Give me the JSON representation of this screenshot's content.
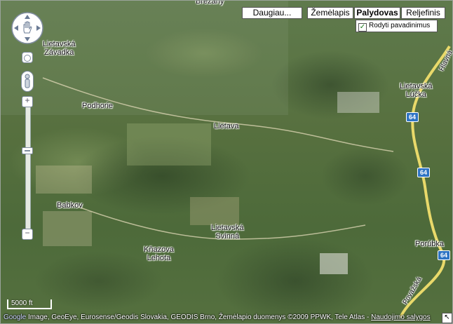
{
  "map_types": [
    {
      "label": "Daugiau...",
      "active": false
    },
    {
      "label": "Žemėlapis",
      "active": false
    },
    {
      "label": "Palydovas",
      "active": true
    },
    {
      "label": "Reljefinis",
      "active": false
    }
  ],
  "labels_toggle": {
    "label": "Rodyti pavadinimus",
    "checked": true
  },
  "places": {
    "brezany": "Brezany",
    "lietavska_zavadka_1": "Lietavská",
    "lietavska_zavadka_2": "Závadka",
    "podhorie": "Podhorie",
    "lietava": "Lietava",
    "lietavska_lucka_1": "Lietavská",
    "lietavska_lucka_2": "Lúčka",
    "babkov": "Babkov",
    "lietavska_svinna_1": "Lietavská",
    "lietavska_svinna_2": "Svinná",
    "knazova_lehota_1": "Kňazova",
    "knazova_lehota_2": "Lehota",
    "porubka": "Porúbka"
  },
  "roads": {
    "hlavna": "Hlavná",
    "povazska": "Považská",
    "shield_64": "64"
  },
  "scale": {
    "label": "5000 ft"
  },
  "attribution": {
    "logo": "Google",
    "text": "Image, GeoEye, Eurosense/Geodis Slovakia, GEODIS Brno, Žemėlapio duomenys ©2009 PPWK, Tele Atlas - ",
    "terms_link": "Naudojimo salygos"
  },
  "colors": {
    "road": "#e9d96a",
    "road_shield": "#2f74c4"
  }
}
